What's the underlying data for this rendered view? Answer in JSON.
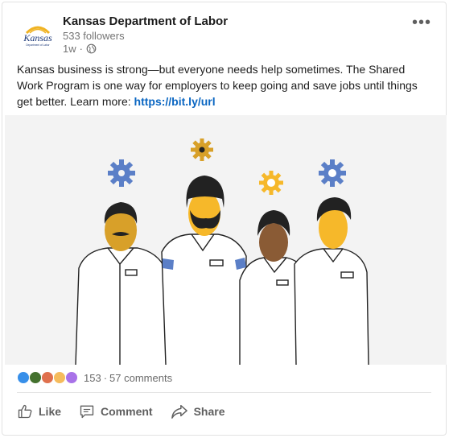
{
  "post": {
    "author": "Kansas Department of Labor",
    "followers": "533 followers",
    "time": "1w",
    "separator": "·",
    "logo_text": "Kansas",
    "logo_subtext": "Department of Labor",
    "text": "Kansas business is strong—but everyone needs help sometimes. The Shared Work Program is one way for employers to keep going and save jobs until things get better. Learn more:",
    "link": "https://bit.ly/url",
    "more_label": "•••"
  },
  "reactions": {
    "icons": [
      "like-icon",
      "clap-icon",
      "love-icon",
      "insightful-icon",
      "curious-icon"
    ],
    "count": "153",
    "dot": "·",
    "comments": "57 comments"
  },
  "actions": {
    "like": "Like",
    "comment": "Comment",
    "share": "Share"
  },
  "colors": {
    "accent_blue": "#5b7fc7",
    "gear_gold": "#d8a029",
    "skin_yellow": "#f6b82a",
    "skin_brown": "#8a5b35",
    "link": "#0a66c2"
  }
}
